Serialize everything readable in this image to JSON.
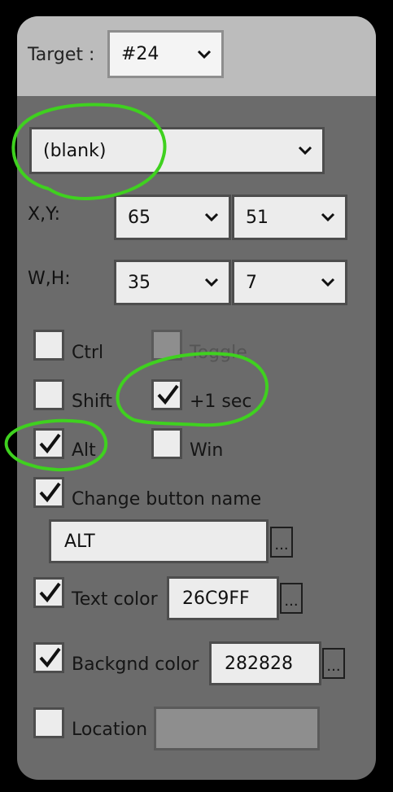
{
  "target": {
    "label": "Target :",
    "value": "#24"
  },
  "mode": {
    "value": "(blank)"
  },
  "position": {
    "label": "X,Y:",
    "x": "65",
    "y": "51"
  },
  "size": {
    "label": "W,H:",
    "w": "35",
    "h": "7"
  },
  "modifiers": {
    "ctrl": {
      "label": "Ctrl",
      "checked": false
    },
    "toggle": {
      "label": "Toggle",
      "checked": false,
      "enabled": false
    },
    "shift": {
      "label": "Shift",
      "checked": false
    },
    "plus_one_sec": {
      "label": "+1 sec",
      "checked": true
    },
    "alt": {
      "label": "Alt",
      "checked": true
    },
    "win": {
      "label": "Win",
      "checked": false
    }
  },
  "change_name": {
    "label": "Change button name",
    "checked": true,
    "value": "ALT",
    "browse": "..."
  },
  "text_color": {
    "label": "Text color",
    "checked": true,
    "value": "26C9FF",
    "browse": "..."
  },
  "back_color": {
    "label": "Backgnd color",
    "checked": true,
    "value": "282828",
    "browse": "..."
  },
  "location": {
    "label": "Location",
    "checked": false,
    "value": ""
  },
  "colors": {
    "panel": "#6b6b6b",
    "header": "#bcbcbc",
    "field": "#ececec",
    "annotation": "#3fd11f"
  }
}
